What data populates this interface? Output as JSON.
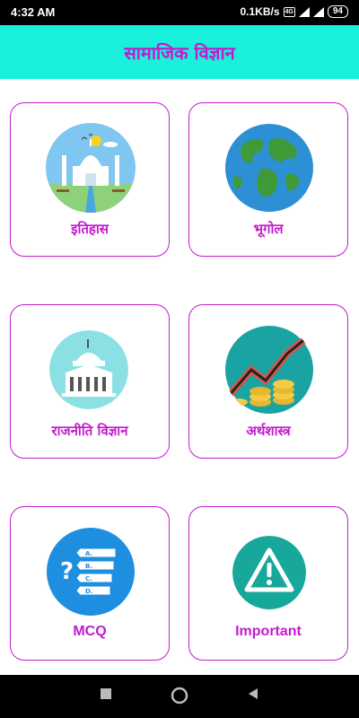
{
  "status_bar": {
    "time": "4:32 AM",
    "speed": "0.1KB/s",
    "battery": "94"
  },
  "header": {
    "title": "सामाजिक विज्ञान"
  },
  "cards": [
    {
      "label": "इतिहास",
      "icon": "taj-mahal-icon"
    },
    {
      "label": "भूगोल",
      "icon": "globe-icon"
    },
    {
      "label": "राजनीति विज्ञान",
      "icon": "parliament-building-icon"
    },
    {
      "label": "अर्थशास्त्र",
      "icon": "coins-growth-chart-icon"
    },
    {
      "label": "MCQ",
      "icon": "quiz-options-icon"
    },
    {
      "label": "Important",
      "icon": "warning-triangle-icon"
    }
  ],
  "colors": {
    "header_bg": "#19f1dc",
    "accent": "#c21bcd"
  }
}
